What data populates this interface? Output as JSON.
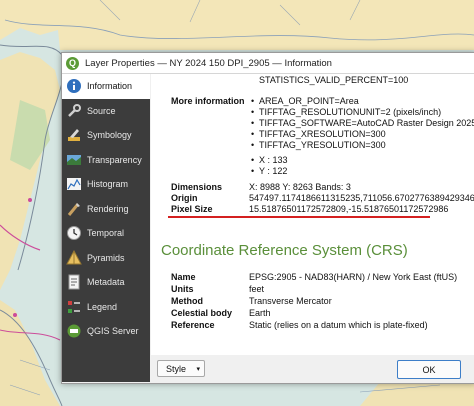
{
  "window": {
    "title": "Layer Properties — NY 2024 150 DPI_2905 — Information"
  },
  "sidebar": {
    "items": [
      {
        "label": "Information",
        "icon": "info-icon",
        "active": true
      },
      {
        "label": "Source",
        "icon": "wrench-icon"
      },
      {
        "label": "Symbology",
        "icon": "paintbrush-icon"
      },
      {
        "label": "Transparency",
        "icon": "transparency-icon"
      },
      {
        "label": "Histogram",
        "icon": "histogram-icon"
      },
      {
        "label": "Rendering",
        "icon": "brush-icon"
      },
      {
        "label": "Temporal",
        "icon": "clock-icon"
      },
      {
        "label": "Pyramids",
        "icon": "pyramid-icon"
      },
      {
        "label": "Metadata",
        "icon": "metadata-icon"
      },
      {
        "label": "Legend",
        "icon": "legend-icon"
      },
      {
        "label": "QGIS Server",
        "icon": "server-icon"
      }
    ]
  },
  "info": {
    "stats_line": "STATISTICS_VALID_PERCENT=100",
    "more_info_label": "More information",
    "more_info_items": [
      "AREA_OR_POINT=Area",
      "TIFFTAG_RESOLUTIONUNIT=2 (pixels/inch)",
      "TIFFTAG_SOFTWARE=AutoCAD Raster Design 2025",
      "TIFFTAG_XRESOLUTION=300",
      "TIFFTAG_YRESOLUTION=300"
    ],
    "xy_items": [
      "X : 133",
      "Y : 122"
    ],
    "dimensions_label": "Dimensions",
    "dimensions_value": "X: 8988 Y: 8263 Bands: 3",
    "origin_label": "Origin",
    "origin_value": "547497.1174186611315235,711056.6702776389429346",
    "pixel_size_label": "Pixel Size",
    "pixel_size_value": "15.51876501172572809,-15.51876501172572986"
  },
  "crs": {
    "heading": "Coordinate Reference System (CRS)",
    "rows": [
      {
        "label": "Name",
        "value": "EPSG:2905 - NAD83(HARN) / New York East (ftUS)"
      },
      {
        "label": "Units",
        "value": "feet"
      },
      {
        "label": "Method",
        "value": "Transverse Mercator"
      },
      {
        "label": "Celestial body",
        "value": "Earth"
      },
      {
        "label": "Reference",
        "value": "Static (relies on a datum which is plate-fixed)"
      }
    ]
  },
  "buttons": {
    "style": "Style",
    "ok": "OK"
  },
  "colors": {
    "sidebar_bg": "#3c3c3c",
    "crs_heading": "#5a8f3a",
    "highlight_line": "#d42020",
    "qgis_green": "#5b9b36"
  }
}
